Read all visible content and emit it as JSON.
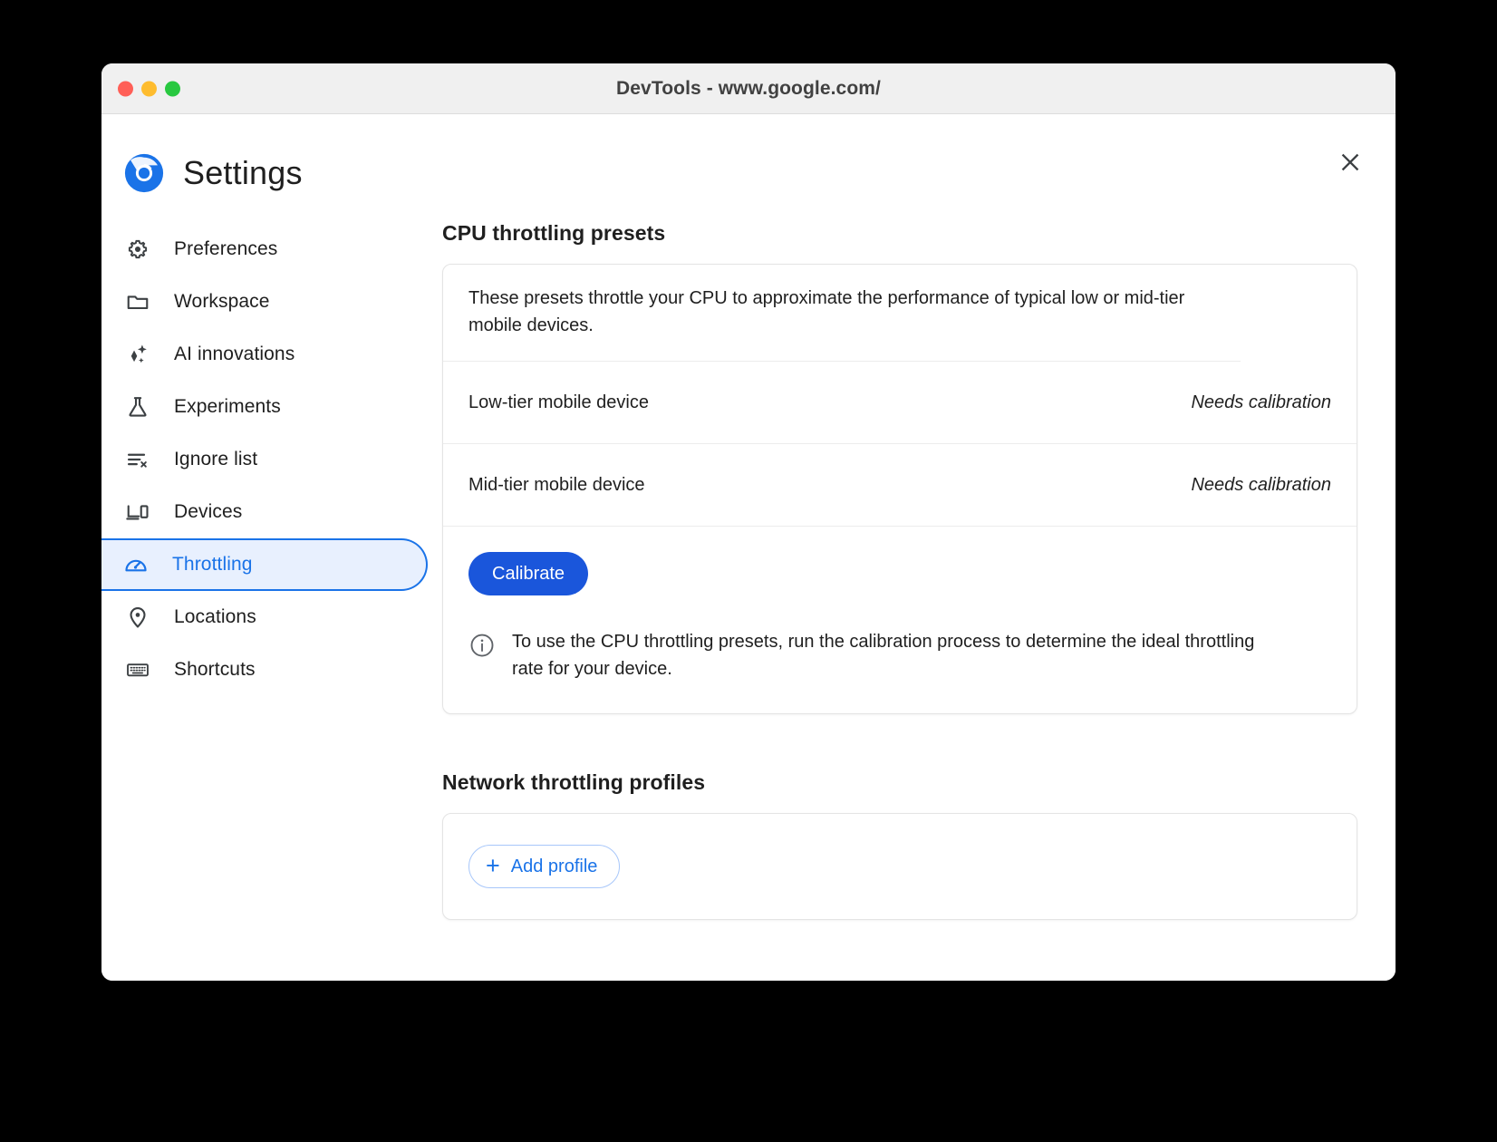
{
  "window": {
    "title": "DevTools - www.google.com/",
    "traffic_lights": [
      {
        "name": "close",
        "color": "#ff5f57"
      },
      {
        "name": "minimize",
        "color": "#febc2e"
      },
      {
        "name": "maximize",
        "color": "#28c840"
      }
    ],
    "close_label": "×"
  },
  "header": {
    "title": "Settings",
    "logo": "chrome-devtools-logo"
  },
  "sidebar": {
    "items": [
      {
        "label": "Preferences",
        "icon": "gear-icon",
        "selected": false
      },
      {
        "label": "Workspace",
        "icon": "folder-icon",
        "selected": false
      },
      {
        "label": "AI innovations",
        "icon": "sparkle-icon",
        "selected": false
      },
      {
        "label": "Experiments",
        "icon": "flask-icon",
        "selected": false
      },
      {
        "label": "Ignore list",
        "icon": "list-x-icon",
        "selected": false
      },
      {
        "label": "Devices",
        "icon": "devices-icon",
        "selected": false
      },
      {
        "label": "Throttling",
        "icon": "speedometer-icon",
        "selected": true
      },
      {
        "label": "Locations",
        "icon": "location-pin-icon",
        "selected": false
      },
      {
        "label": "Shortcuts",
        "icon": "keyboard-icon",
        "selected": false
      }
    ]
  },
  "main": {
    "cpu_section": {
      "title": "CPU throttling presets",
      "description": "These presets throttle your CPU to approximate the performance of typical low or mid-tier mobile devices.",
      "presets": [
        {
          "name": "Low-tier mobile device",
          "status": "Needs calibration"
        },
        {
          "name": "Mid-tier mobile device",
          "status": "Needs calibration"
        }
      ],
      "calibrate_label": "Calibrate",
      "info_icon": "info-circle-icon",
      "info_text": "To use the CPU throttling presets, run the calibration process to determine the ideal throttling rate for your device."
    },
    "network_section": {
      "title": "Network throttling profiles",
      "add_profile_label": "Add profile",
      "add_icon": "plus-icon"
    }
  },
  "colors": {
    "accent": "#1a73e8",
    "primary_button": "#1a56db",
    "selected_bg": "#e8f0fe",
    "text": "#1f1f1f",
    "titlebar": "#f0f0f0"
  }
}
